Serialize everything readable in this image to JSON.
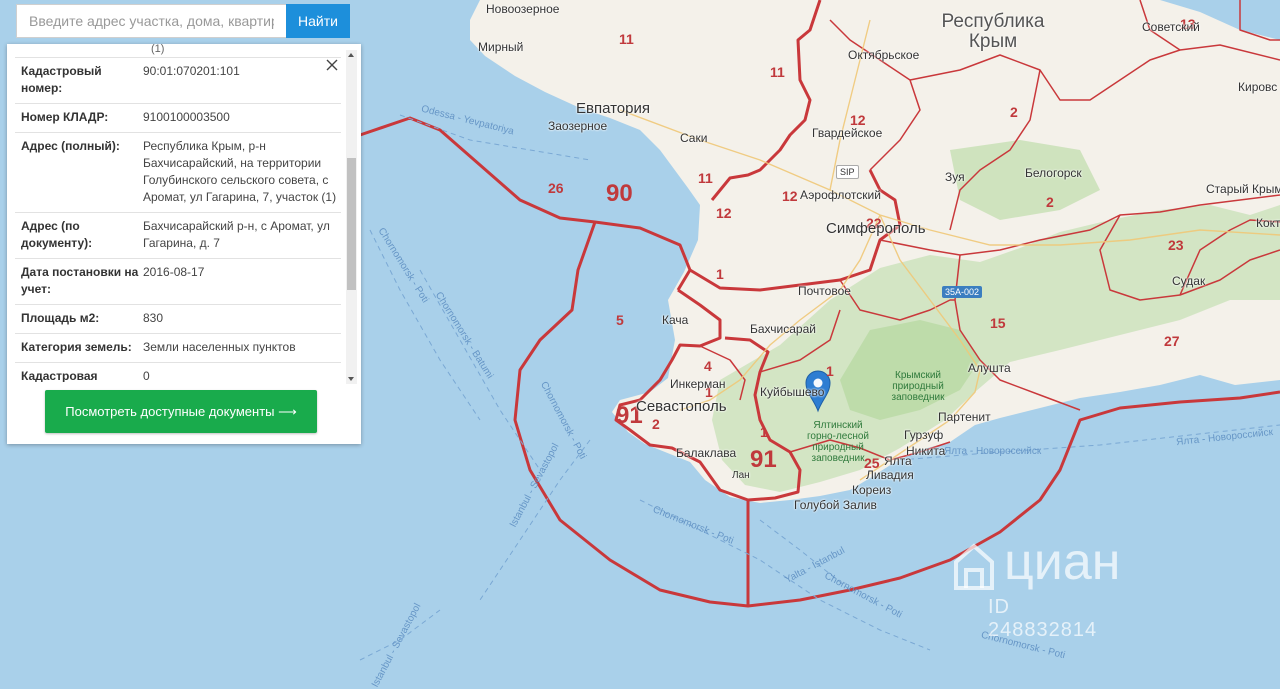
{
  "search": {
    "placeholder": "Введите адрес участка, дома, квартиры",
    "button_label": "Найти"
  },
  "info_panel": {
    "top_partial_text": "(1)",
    "rows": [
      {
        "key": "Кадастровый номер:",
        "value": "90:01:070201:101"
      },
      {
        "key": "Номер КЛАДР:",
        "value": "9100100003500"
      },
      {
        "key": "Адрес (полный):",
        "value": "Республика Крым, р-н Бахчисарайский, на территории Голубинского сельского совета, с Аромат, ул Гагарина, 7, участок (1)"
      },
      {
        "key": "Адрес (по документу):",
        "value": "Бахчисарайский р-н, с Аромат, ул Гагарина, д. 7"
      },
      {
        "key": "Дата постановки на учет:",
        "value": "2016-08-17"
      },
      {
        "key": "Площадь м2:",
        "value": "830"
      },
      {
        "key": "Категория земель:",
        "value": "Земли населенных пунктов"
      },
      {
        "key": "Кадастровая",
        "value": "0"
      }
    ],
    "docs_button_label": "Посмотреть доступные документы ⟶"
  },
  "map": {
    "colors": {
      "sea": "#a9d0ea",
      "land": "#f4f1ea",
      "border": "#c9383b",
      "marker": "#2d7dd2"
    },
    "region_numbers": [
      "90",
      "91",
      "11",
      "11",
      "11",
      "12",
      "12",
      "12",
      "22",
      "26",
      "5",
      "4",
      "1",
      "1",
      "1",
      "1",
      "2",
      "2",
      "2",
      "91",
      "15",
      "23",
      "25",
      "27",
      "13"
    ],
    "cities": [
      "Новоозерное",
      "Мирный",
      "Евпатория",
      "Заозерное",
      "Саки",
      "Октябрьское",
      "Гвардейское",
      "Аэрофлотский",
      "Симферополь",
      "Зуя",
      "Белогорск",
      "Советский",
      "Кировс",
      "Старый Крым",
      "Кокт",
      "Судак",
      "Почтовое",
      "Бахчисарай",
      "Кача",
      "Инкерман",
      "Севастополь",
      "Балаклава",
      "Куйбышево",
      "Алушта",
      "Партенит",
      "Гурзуф",
      "Ялта",
      "Никита",
      "Ливадия",
      "Кореиз",
      "Голубой Залив",
      "Лан"
    ],
    "region_title": "Республика Крым",
    "parks": [
      "Крымский природный заповедник",
      "Ялтинский горно-лесной природный заповедник"
    ],
    "road_badge": "35А-002",
    "road_badge_2": "SIP",
    "sea_routes": [
      "Odessa - Yevpatoriya",
      "Chornomorsk - Poti",
      "Chornomorsk - Batumi",
      "Istanbul - Sevastopol",
      "Chornomorsk - Poti",
      "Yalta - Istanbul",
      "Chornomorsk - Poti",
      "Chornomorsk - Poti",
      "Istanbul - Sevastopol",
      "Chornomorsk - Poti",
      "Ялта - Новороссийск",
      "Ялта - Новороссийск"
    ],
    "marker_icon": "map-pin-icon"
  },
  "watermark": {
    "brand": "циан",
    "id_text": "ID 248832814",
    "icon": "cian-house-icon"
  }
}
